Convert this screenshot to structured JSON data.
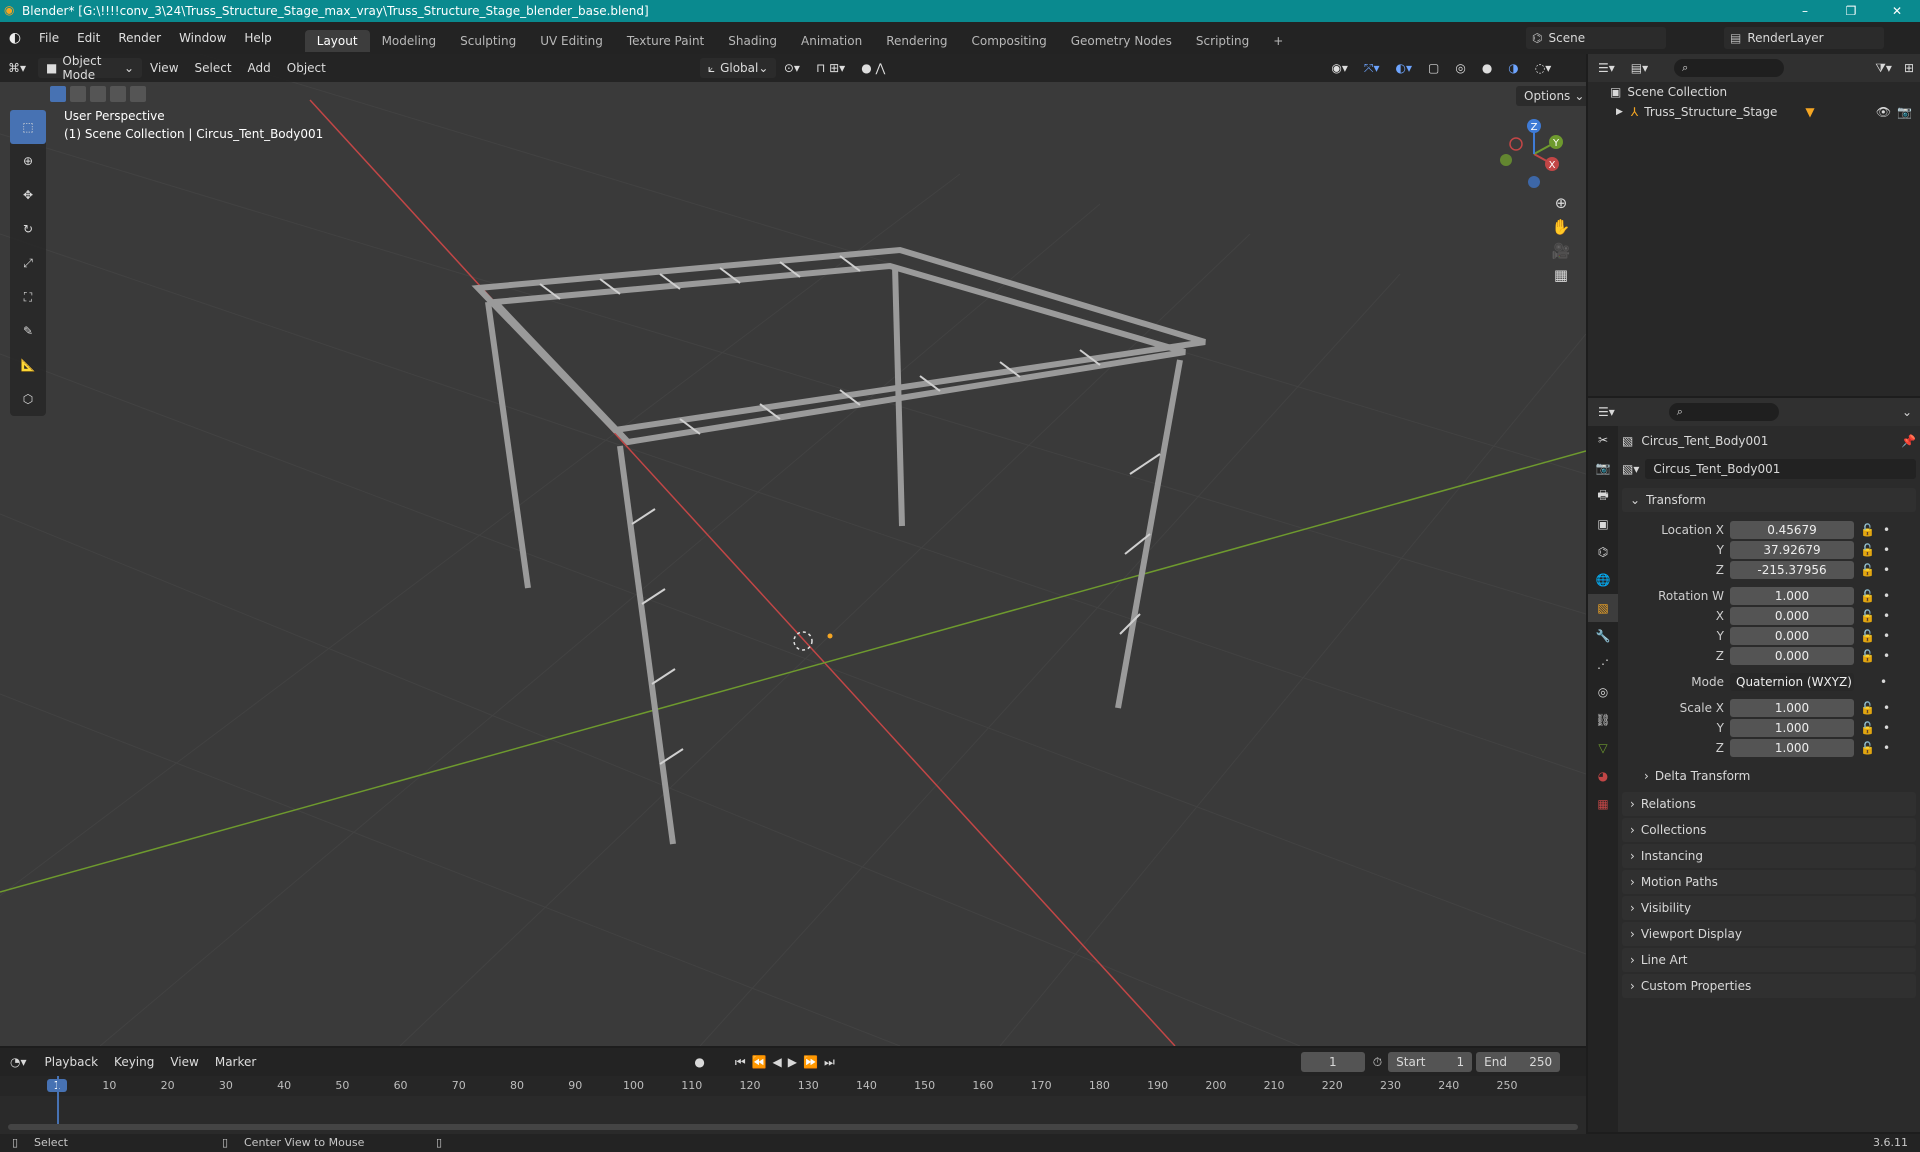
{
  "window": {
    "title": "Blender* [G:\\!!!!conv_3\\24\\Truss_Structure_Stage_max_vray\\Truss_Structure_Stage_blender_base.blend]",
    "controls": [
      "–",
      "❐",
      "✕"
    ]
  },
  "menu": [
    "File",
    "Edit",
    "Render",
    "Window",
    "Help"
  ],
  "workspaces": [
    "Layout",
    "Modeling",
    "Sculpting",
    "UV Editing",
    "Texture Paint",
    "Shading",
    "Animation",
    "Rendering",
    "Compositing",
    "Geometry Nodes",
    "Scripting"
  ],
  "active_workspace": "Layout",
  "scene": "Scene",
  "render_layer": "RenderLayer",
  "viewport": {
    "mode": "Object Mode",
    "menus": [
      "View",
      "Select",
      "Add",
      "Object"
    ],
    "orientation": "Global",
    "options_label": "Options",
    "perspective": "User Perspective",
    "collection_info": "(1) Scene Collection | Circus_Tent_Body001",
    "gizmo_axes": [
      "X",
      "Y",
      "Z"
    ]
  },
  "outliner": {
    "root": "Scene Collection",
    "items": [
      {
        "name": "Truss_Structure_Stage"
      }
    ]
  },
  "properties": {
    "object_name": "Circus_Tent_Body001",
    "data_name": "Circus_Tent_Body001",
    "transform_label": "Transform",
    "location": {
      "label": "Location X",
      "x": "0.45679",
      "y": "37.92679",
      "z": "-215.37956"
    },
    "rotation": {
      "label": "Rotation W",
      "w": "1.000",
      "x": "0.000",
      "y": "0.000",
      "z": "0.000"
    },
    "mode_label": "Mode",
    "mode_value": "Quaternion (WXYZ)",
    "scale": {
      "label": "Scale X",
      "x": "1.000",
      "y": "1.000",
      "z": "1.000"
    },
    "axis_labels": {
      "y": "Y",
      "z": "Z",
      "x": "X"
    },
    "delta": "Delta Transform",
    "panels": [
      "Relations",
      "Collections",
      "Instancing",
      "Motion Paths",
      "Visibility",
      "Viewport Display",
      "Line Art",
      "Custom Properties"
    ]
  },
  "timeline": {
    "menus": [
      "Playback",
      "Keying",
      "View",
      "Marker"
    ],
    "current_frame": "1",
    "start_label": "Start",
    "start": "1",
    "end_label": "End",
    "end": "250",
    "ticks": [
      "1",
      "10",
      "20",
      "30",
      "40",
      "50",
      "60",
      "70",
      "80",
      "90",
      "100",
      "110",
      "120",
      "130",
      "140",
      "150",
      "160",
      "170",
      "180",
      "190",
      "200",
      "210",
      "220",
      "230",
      "240",
      "250"
    ]
  },
  "status": {
    "select": "Select",
    "center": "Center View to Mouse",
    "version": "3.6.11"
  }
}
